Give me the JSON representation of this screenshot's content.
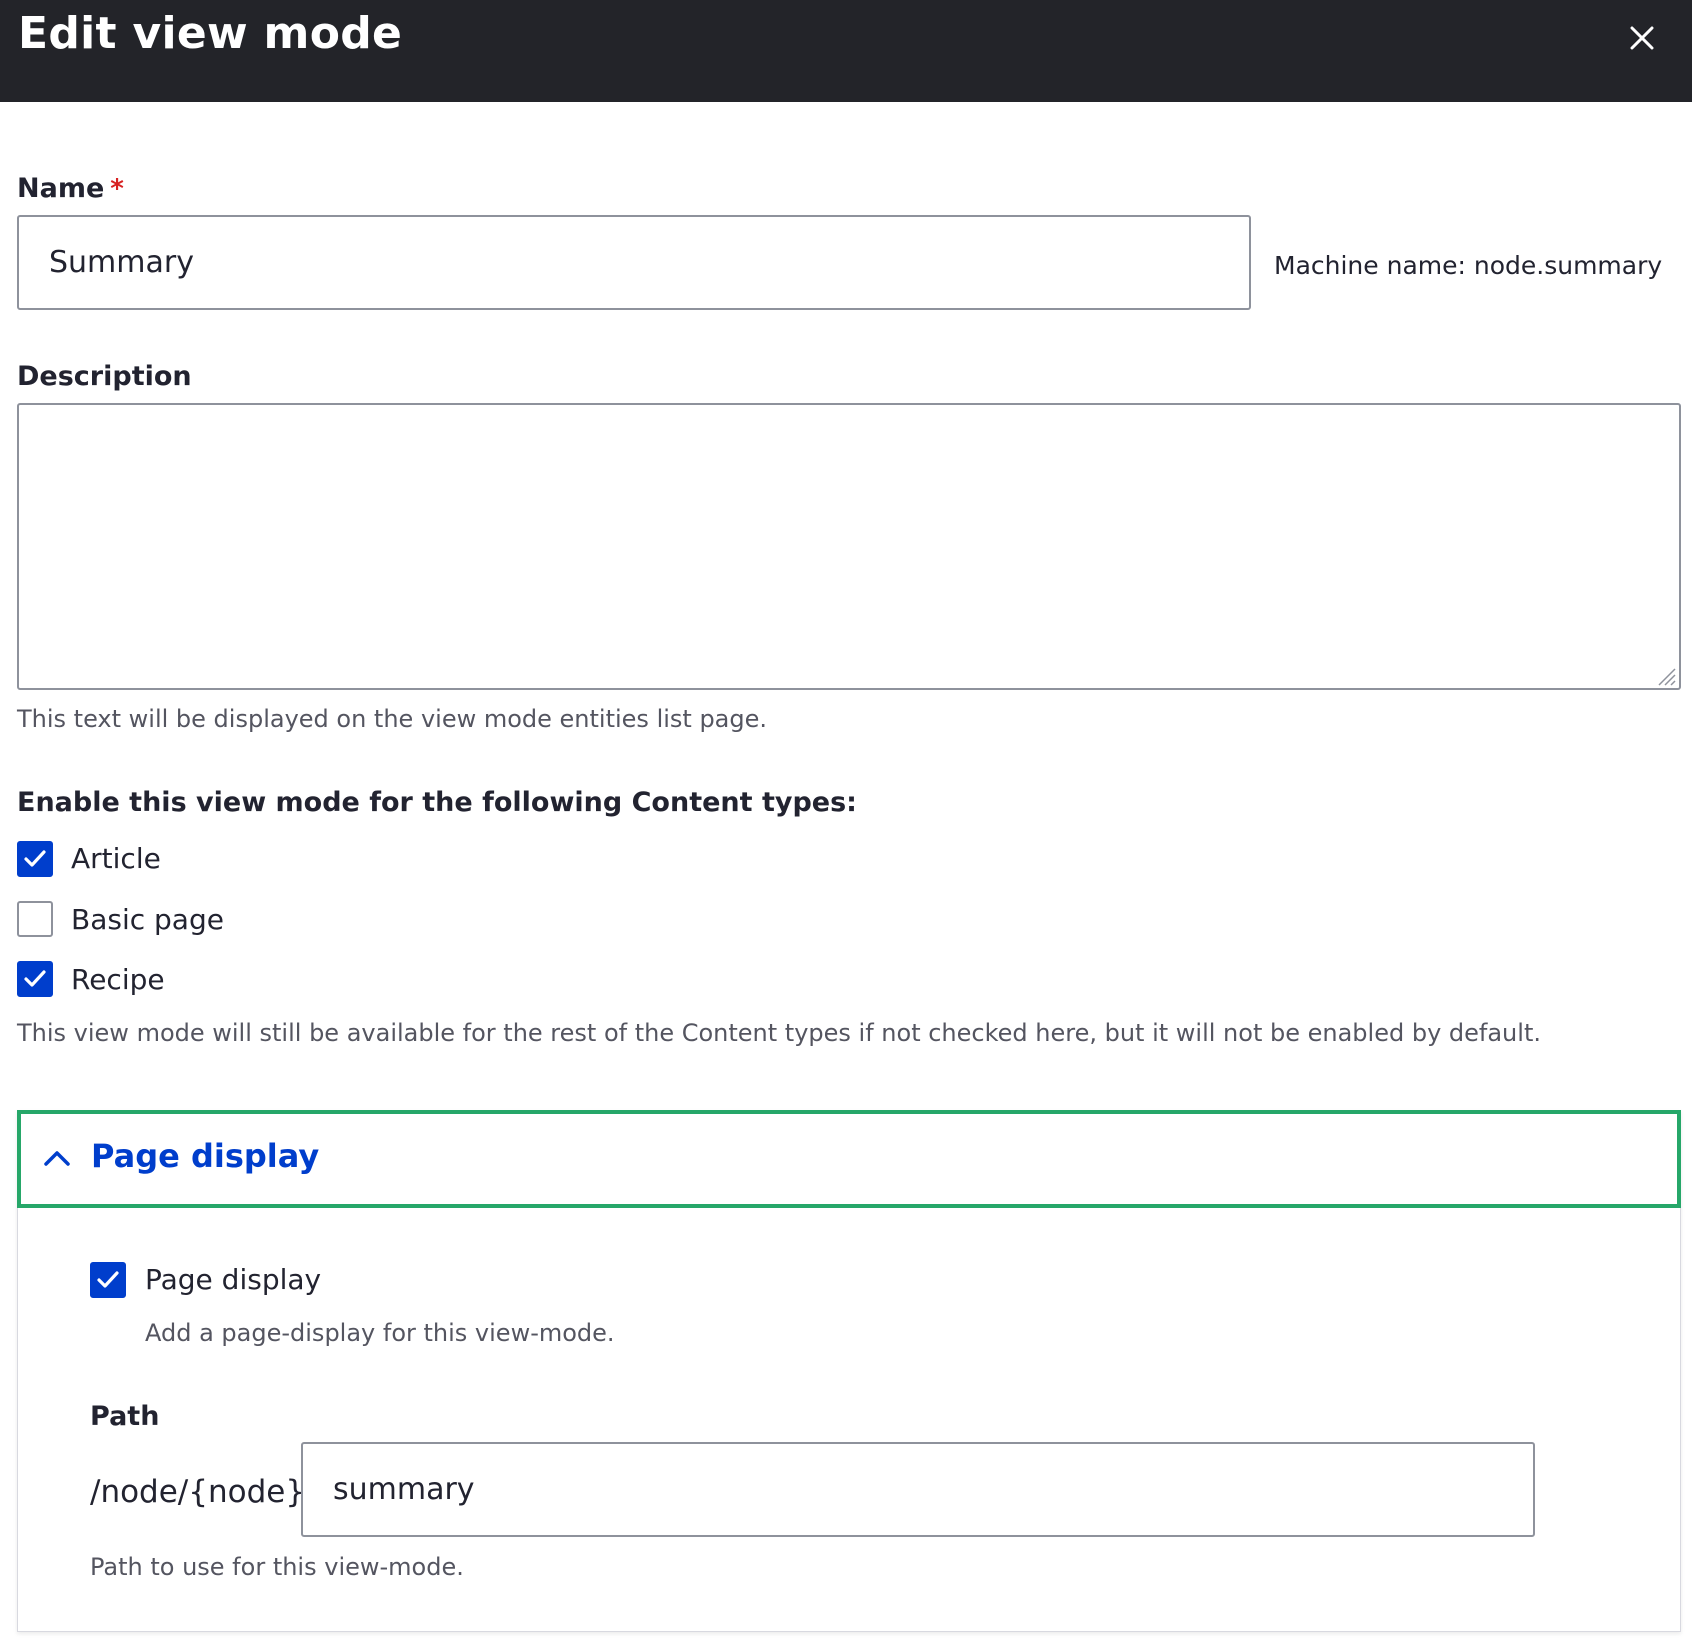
{
  "dialog": {
    "title": "Edit view mode",
    "close_label": "Close"
  },
  "name_field": {
    "label": "Name",
    "required_marker": "*",
    "value": "Summary",
    "machine_name": "Machine name: node.summary"
  },
  "description_field": {
    "label": "Description",
    "value": "",
    "help": "This text will be displayed on the view mode entities list page."
  },
  "content_types": {
    "label": "Enable this view mode for the following Content types:",
    "options": [
      {
        "label": "Article",
        "checked": true
      },
      {
        "label": "Basic page",
        "checked": false
      },
      {
        "label": "Recipe",
        "checked": true
      }
    ],
    "help": "This view mode will still be available for the rest of the Content types if not checked here, but it will not be enabled by default."
  },
  "page_display": {
    "summary": "Page display",
    "expanded": true,
    "checkbox_label": "Page display",
    "checkbox_checked": true,
    "checkbox_help": "Add a page-display for this view-mode.",
    "path_label": "Path",
    "path_prefix": "/node/{node}/",
    "path_value": "summary",
    "path_help": "Path to use for this view-mode."
  },
  "colors": {
    "header_bg": "#232429",
    "accent_blue": "#003ecc",
    "focus_green": "#26a769",
    "required_red": "#d72222"
  }
}
